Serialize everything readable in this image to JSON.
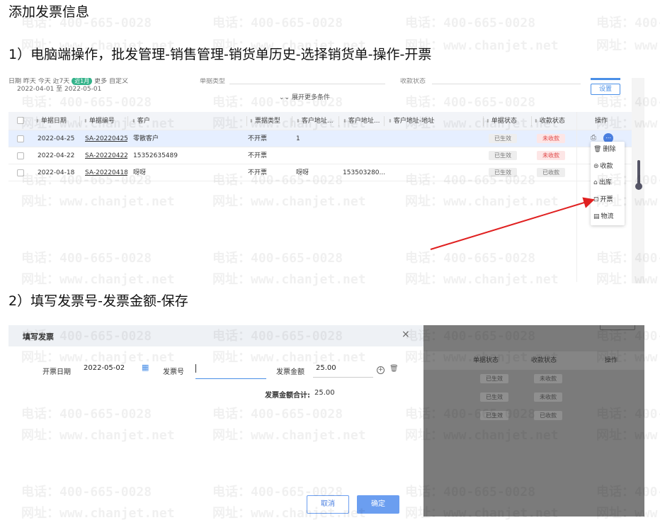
{
  "headings": {
    "main": "添加发票信息",
    "step1": "1）电脑端操作，批发管理-销售管理-销货单历史-选择销货单-操作-开票",
    "step2": "2）填写发票号-发票金额-保存"
  },
  "watermark": {
    "phone": "电话：400-665-0028",
    "site": "网址：www.chanjet.net"
  },
  "list_screen": {
    "filter": {
      "shortcuts": "日期 昨天 今天 近7天",
      "badge": "近1月",
      "more_label": "更多 自定义",
      "date_range": "2022-04-01 至 2022-05-01",
      "type_label": "单据类型",
      "status_label": "收款状态",
      "expand_label": "展开更多条件",
      "settings_label": "设置"
    },
    "columns": [
      "单据日期",
      "单据编号",
      "客户",
      "票据类型",
      "客户地址...",
      "客户地址...",
      "客户地址-地址",
      "单据状态",
      "收款状态",
      "操作"
    ],
    "rows": [
      {
        "date": "2022-04-25",
        "code": "SA-20220425-(",
        "customer": "零散客户",
        "invoice_type": "不开票",
        "addr1": "1",
        "addr2": "",
        "addr3": "",
        "doc_status": "已生效",
        "pay_status": "未收款"
      },
      {
        "date": "2022-04-22",
        "code": "SA-20220422-(",
        "customer": "15352635489",
        "invoice_type": "不开票",
        "addr1": "",
        "addr2": "",
        "addr3": "",
        "doc_status": "已生效",
        "pay_status": "未收款"
      },
      {
        "date": "2022-04-18",
        "code": "SA-20220418-(",
        "customer": "呀呀",
        "invoice_type": "不开票",
        "addr1": "呀呀",
        "addr2": "153503280...",
        "addr3": "",
        "doc_status": "已生效",
        "pay_status": "已收款"
      }
    ],
    "menu": {
      "delete": "删除",
      "collect": "收款",
      "outbound": "出库",
      "invoice": "开票",
      "logistics": "物流"
    },
    "colors": {
      "accent": "#4a7fe0",
      "arrow": "#e02020",
      "unpaid": "#e04646"
    }
  },
  "invoice_dialog": {
    "title": "填写发票",
    "date_label": "开票日期",
    "date_value": "2022-05-02",
    "number_label": "发票号",
    "number_value": "",
    "amount_label": "发票金额",
    "amount_value": "25.00",
    "total_label": "发票金额合计:",
    "total_value": "25.00",
    "cancel_label": "取消",
    "ok_label": "确定",
    "bg_columns": [
      "单据状态",
      "收款状态",
      "操作"
    ],
    "bg_rows": [
      {
        "doc_status": "已生效",
        "pay_status": "未收款"
      },
      {
        "doc_status": "已生效",
        "pay_status": "未收款"
      },
      {
        "doc_status": "已生效",
        "pay_status": "已收款"
      }
    ]
  }
}
